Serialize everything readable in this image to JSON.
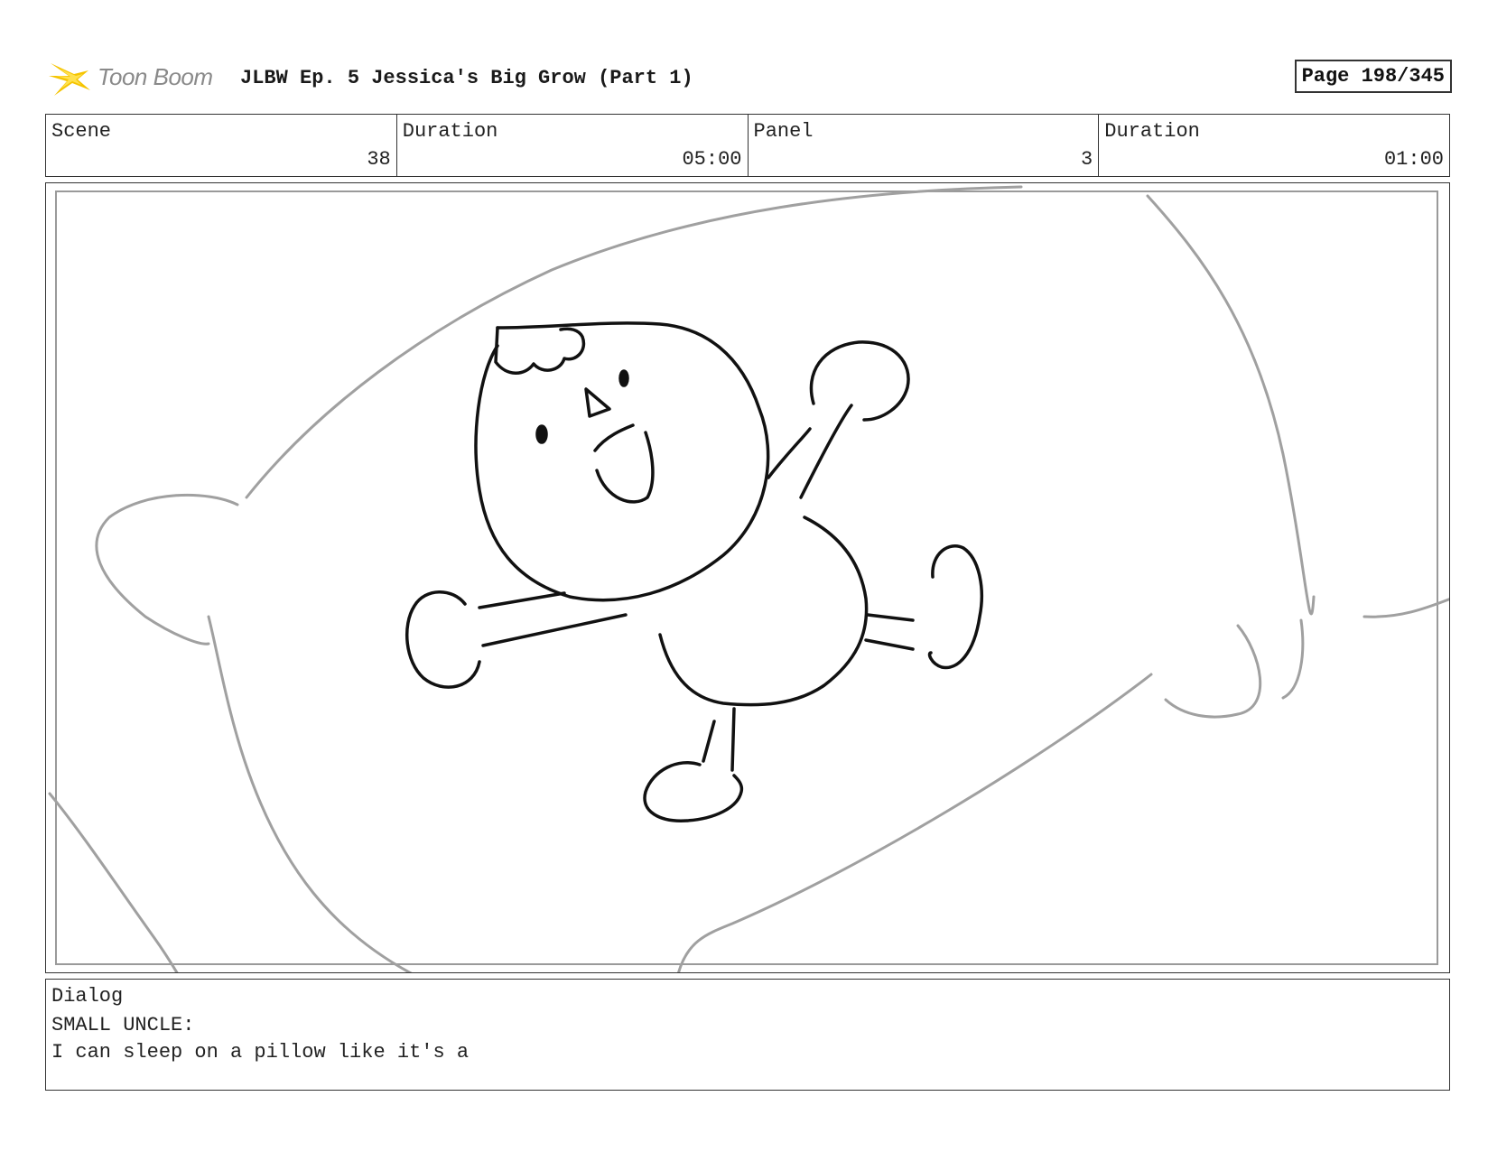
{
  "header": {
    "logo_text": "Toon Boom",
    "title": "JLBW Ep. 5 Jessica's Big Grow (Part 1)",
    "page_label": "Page 198/345"
  },
  "info": {
    "scene_label": "Scene",
    "scene_value": "38",
    "scene_duration_label": "Duration",
    "scene_duration_value": "05:00",
    "panel_label": "Panel",
    "panel_value": "3",
    "panel_duration_label": "Duration",
    "panel_duration_value": "01:00"
  },
  "dialog": {
    "label": "Dialog",
    "speaker": "SMALL UNCLE:",
    "line": "I can sleep on a pillow like it's a"
  },
  "colors": {
    "border": "#333333",
    "sketch_line": "#111111",
    "pillow_line": "#a0a0a0",
    "logo_yellow": "#f5c400",
    "logo_text": "#8a8a8a"
  },
  "icons": {
    "logo": "toon-boom-starburst-icon"
  }
}
